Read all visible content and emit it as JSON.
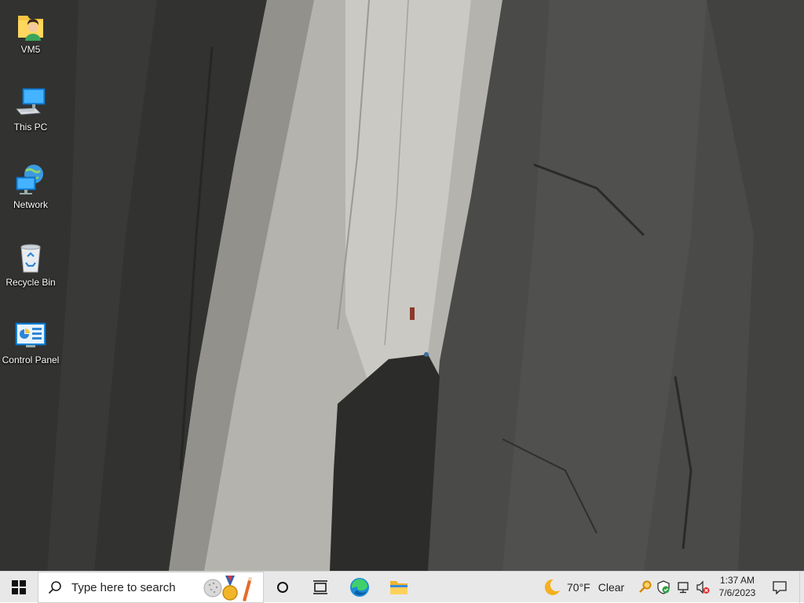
{
  "desktop": {
    "icons": [
      {
        "label": "VM5",
        "icon": "user-folder-icon"
      },
      {
        "label": "This PC",
        "icon": "computer-icon"
      },
      {
        "label": "Network",
        "icon": "network-icon"
      },
      {
        "label": "Recycle Bin",
        "icon": "recycle-bin-icon"
      },
      {
        "label": "Control Panel",
        "icon": "control-panel-icon"
      }
    ]
  },
  "taskbar": {
    "start_icon": "windows-logo-icon",
    "search": {
      "placeholder": "Type here to search"
    },
    "pinned": [
      {
        "name": "cortana",
        "icon": "cortana-circle-icon"
      },
      {
        "name": "task-view",
        "icon": "task-view-icon"
      },
      {
        "name": "edge",
        "icon": "edge-icon"
      },
      {
        "name": "file-explorer",
        "icon": "folder-icon"
      }
    ],
    "weather": {
      "temperature": "70°F",
      "condition": "Clear",
      "icon": "moon-icon"
    },
    "tray": [
      "search-key-icon",
      "shield-icon",
      "network-icon",
      "volume-muted-icon"
    ],
    "clock": {
      "time": "1:37 AM",
      "date": "7/6/2023"
    }
  },
  "colors": {
    "taskbar_bg": "#e8e8e8",
    "accent_blue": "#0078d7"
  }
}
